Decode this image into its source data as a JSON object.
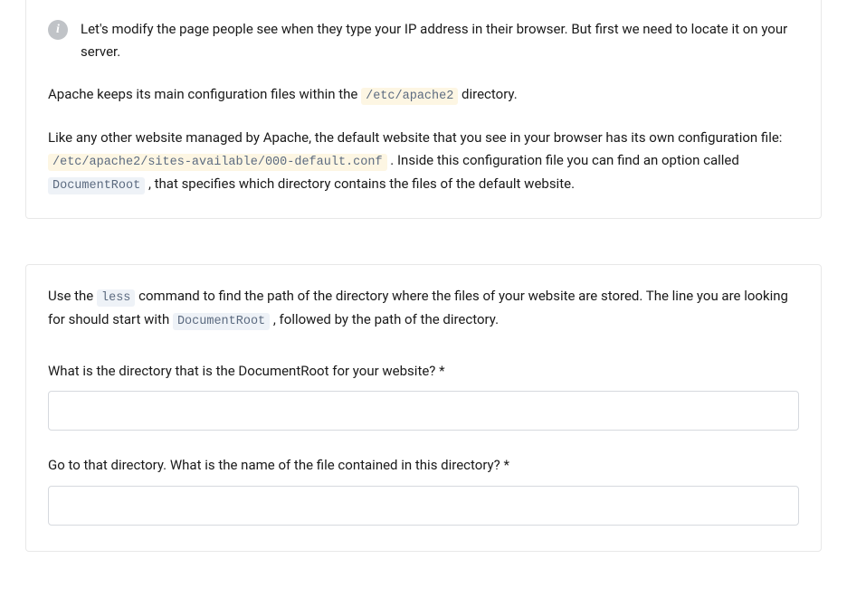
{
  "info_card": {
    "icon_glyph": "i",
    "intro_text": "Let's modify the page people see when they type your IP address in their browser. But first we need to locate it on your server.",
    "para1_a": "Apache keeps its main configuration files within the ",
    "para1_code": "/etc/apache2",
    "para1_b": " directory.",
    "para2_a": "Like any other website managed by Apache, the default website that you see in your browser has its own configuration file: ",
    "para2_code1": "/etc/apache2/sites-available/000-default.conf",
    "para2_b": " . Inside this configuration file you can find an option called ",
    "para2_code2": "DocumentRoot",
    "para2_c": " , that specifies which directory contains the files of the default website."
  },
  "task_card": {
    "instruct_a": "Use the ",
    "instruct_code1": "less",
    "instruct_b": " command to find the path of the directory where the files of your website are stored. The line you are looking for should start with ",
    "instruct_code2": "DocumentRoot",
    "instruct_c": " , followed by the path of the directory.",
    "q1_label": "What is the directory that is the DocumentRoot for your website? *",
    "q1_value": "",
    "q2_label": "Go to that directory. What is the name of the file contained in this directory? *",
    "q2_value": ""
  }
}
